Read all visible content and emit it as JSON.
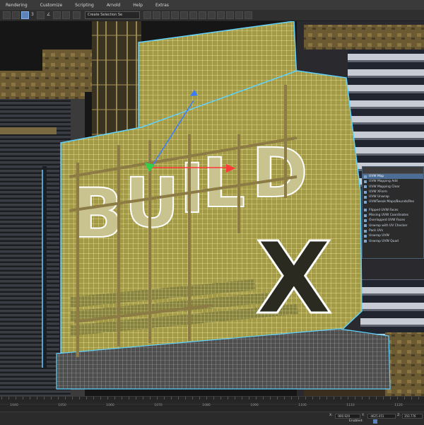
{
  "menu": [
    "Rendering",
    "Customize",
    "Scripting",
    "Arnold",
    "Help",
    "Extras"
  ],
  "toolbar": {
    "create_selection_set": "Create Selection Se",
    "snap_label": "3",
    "angle_label": "∠"
  },
  "viewport": {
    "sign_letters": [
      "B",
      "U",
      "I",
      "L",
      "D"
    ],
    "sign_x": "X"
  },
  "uvw_panel": {
    "title": "",
    "items": [
      {
        "label": "UVW Map",
        "selected": true
      },
      {
        "label": "UVW Mapping Add",
        "selected": false
      },
      {
        "label": "UVW Mapping Clear",
        "selected": false
      },
      {
        "label": "UVW XForm",
        "selected": false
      },
      {
        "label": "UVW Unwrap",
        "selected": false
      },
      {
        "label": "UVWTweak Maps/Bounds/Res",
        "selected": false
      },
      {
        "label": "Flipped UVW Faces",
        "selected": false
      },
      {
        "label": "Missing UVW Coordinates",
        "selected": false
      },
      {
        "label": "Overlapped UVW Faces",
        "selected": false
      },
      {
        "label": "Unwrap with UV Checker",
        "selected": false
      },
      {
        "label": "Pack UVs",
        "selected": false
      },
      {
        "label": "Unwrap UVW",
        "selected": false
      },
      {
        "label": "Unwrap UVW Quad",
        "selected": false
      }
    ]
  },
  "timeline": {
    "ticks": [
      "1040",
      "1050",
      "1060",
      "1070",
      "1080",
      "1090",
      "1100",
      "1110",
      "1120"
    ]
  },
  "status": {
    "x_label": "X:",
    "x_value": "-900.929",
    "y_label": "Y:",
    "y_value": "-4625.051",
    "z_label": "Z:",
    "z_value": "350.776",
    "enabled_label": "Enabled:"
  },
  "colors": {
    "wire": "#f3ea9c",
    "mesh_fill": "#a39a47",
    "selection_outline": "#5fd2ff",
    "panel_selected": "#4c6e96"
  }
}
